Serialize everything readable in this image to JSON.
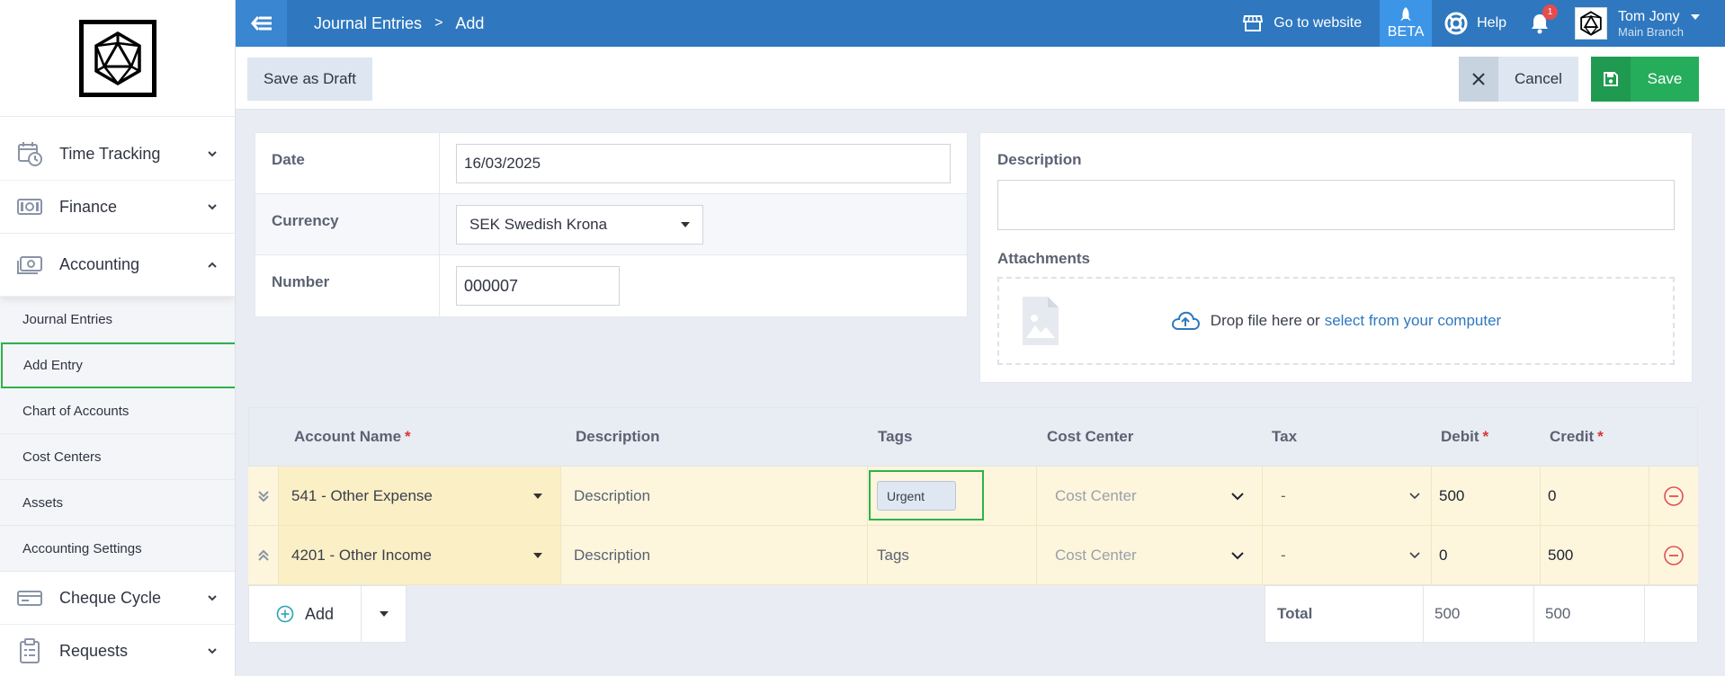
{
  "sidebar": {
    "items": [
      {
        "label": "Time Tracking",
        "icon": "calendar-clock-icon"
      },
      {
        "label": "Finance",
        "icon": "cash-icon"
      },
      {
        "label": "Accounting",
        "icon": "money-stack-icon"
      }
    ],
    "submenu": [
      {
        "label": "Journal Entries"
      },
      {
        "label": "Add Entry"
      },
      {
        "label": "Chart of Accounts"
      },
      {
        "label": "Cost Centers"
      },
      {
        "label": "Assets"
      },
      {
        "label": "Accounting Settings"
      }
    ],
    "bottom_items": [
      {
        "label": "Cheque Cycle",
        "icon": "cheque-icon"
      },
      {
        "label": "Requests",
        "icon": "clipboard-icon"
      }
    ]
  },
  "topbar": {
    "breadcrumb": [
      "Journal Entries",
      "Add"
    ],
    "separator": ">",
    "goto_website": "Go to website",
    "beta": "BETA",
    "help": "Help",
    "notifications": "1",
    "user_name": "Tom Jony",
    "user_branch": "Main Branch",
    "brand_color": "#2f78bf"
  },
  "actions": {
    "draft": "Save as Draft",
    "cancel": "Cancel",
    "save": "Save"
  },
  "form": {
    "date_label": "Date",
    "date_value": "16/03/2025",
    "currency_label": "Currency",
    "currency_value": "SEK Swedish Krona",
    "number_label": "Number",
    "number_value": "000007",
    "description_label": "Description",
    "attachments_label": "Attachments",
    "drop_text": "Drop file here or",
    "drop_link": "select from your computer"
  },
  "table": {
    "headers": {
      "account": "Account Name",
      "description": "Description",
      "tags": "Tags",
      "cost_center": "Cost Center",
      "tax": "Tax",
      "debit": "Debit",
      "credit": "Credit",
      "required_mark": "*"
    },
    "rows": [
      {
        "account": "541 - Other Expense",
        "description": "Description",
        "tag": "Urgent",
        "cost_center": "Cost Center",
        "tax": "-",
        "debit": "500",
        "credit": "0"
      },
      {
        "account": "4201 - Other Income",
        "description": "Description",
        "tags_placeholder": "Tags",
        "cost_center": "Cost Center",
        "tax": "-",
        "debit": "0",
        "credit": "500"
      }
    ],
    "add_label": "Add",
    "total_label": "Total",
    "total_debit": "500",
    "total_credit": "500"
  }
}
